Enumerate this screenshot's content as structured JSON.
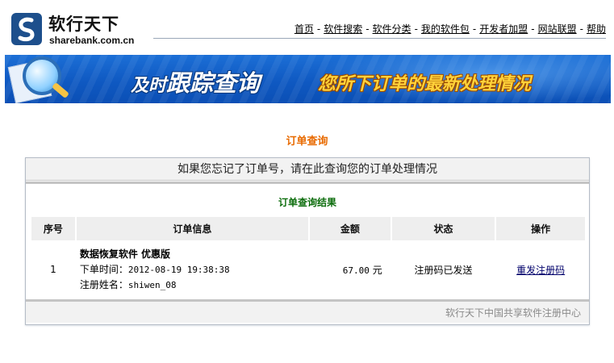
{
  "logo": {
    "name_cn": "软行天下",
    "domain": "sharebank.com.cn"
  },
  "nav": {
    "items": [
      "首页",
      "软件搜索",
      "软件分类",
      "我的软件包",
      "开发者加盟",
      "网站联盟",
      "帮助"
    ],
    "separator": "-"
  },
  "banner": {
    "left_small": "及时",
    "left_big": "跟踪查询",
    "right": "您所下订单的最新处理情况"
  },
  "page_title": "订单查询",
  "hint": "如果您忘记了订单号，请在此查询您的订单处理情况",
  "result_title": "订单查询结果",
  "table": {
    "headers": [
      "序号",
      "订单信息",
      "金额",
      "状态",
      "操作"
    ],
    "rows": [
      {
        "index": "1",
        "product": "数据恢复软件 优惠版",
        "order_time_label": "下单时间：",
        "order_time": "2012-08-19 19:38:38",
        "reg_name_label": "注册姓名：",
        "reg_name": "shiwen_08",
        "amount": "67.00",
        "currency": "元",
        "status": "注册码已发送",
        "action": "重发注册码"
      }
    ]
  },
  "footer": "软行天下中国共享软件注册中心",
  "colors": {
    "title_orange": "#e86a00",
    "result_green": "#0c6d0c",
    "banner_blue": "#0f59c2",
    "banner_yellow": "#ffd23a"
  }
}
